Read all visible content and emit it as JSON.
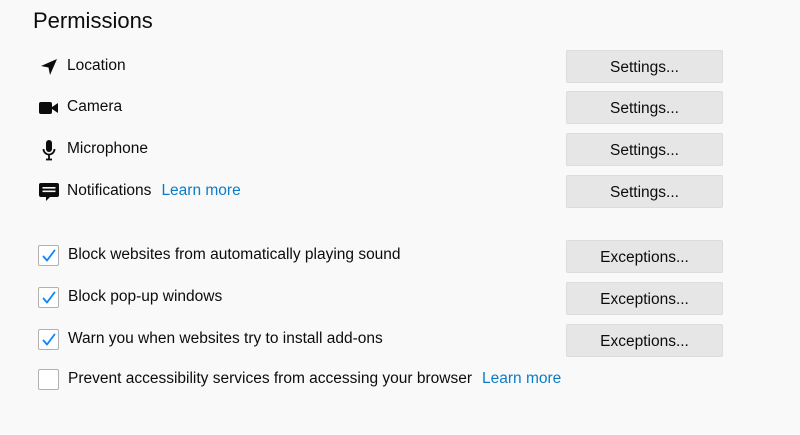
{
  "section": {
    "title": "Permissions"
  },
  "permissions": [
    {
      "label": "Location",
      "icon": "location-arrow-icon",
      "button": "Settings..."
    },
    {
      "label": "Camera",
      "icon": "camera-icon",
      "button": "Settings..."
    },
    {
      "label": "Microphone",
      "icon": "microphone-icon",
      "button": "Settings..."
    },
    {
      "label": "Notifications",
      "icon": "notification-bubble-icon",
      "button": "Settings...",
      "link": "Learn more"
    }
  ],
  "options": [
    {
      "label": "Block websites from automatically playing sound",
      "checked": true,
      "button": "Exceptions..."
    },
    {
      "label": "Block pop-up windows",
      "checked": true,
      "button": "Exceptions..."
    },
    {
      "label": "Warn you when websites try to install add-ons",
      "checked": true,
      "button": "Exceptions..."
    },
    {
      "label": "Prevent accessibility services from accessing your browser",
      "checked": false,
      "link": "Learn more"
    }
  ],
  "colors": {
    "background": "#f9f9fa",
    "link": "#0b7dc6",
    "checkmark": "#0a84ff",
    "button_bg": "#e6e6e6"
  }
}
